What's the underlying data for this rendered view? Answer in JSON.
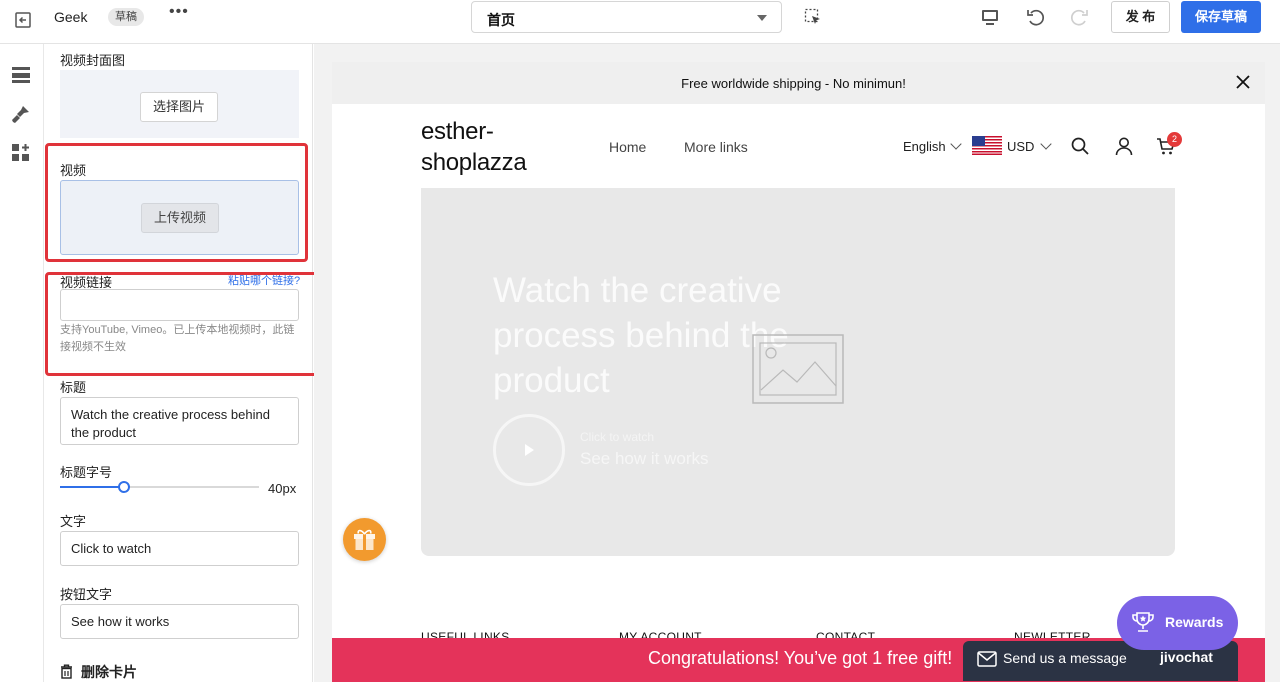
{
  "topbar": {
    "title": "Geek",
    "badge": "草稿",
    "page_select": "首页",
    "publish": "发 布",
    "save_draft": "保存草稿"
  },
  "panel": {
    "cover_label": "视频封面图",
    "choose_image": "选择图片",
    "video_label": "视频",
    "upload_video": "上传视频",
    "video_link_label": "视频链接",
    "paste_link": "粘贴哪个链接?",
    "video_link_value": "",
    "video_link_help": "支持YouTube, Vimeo。已上传本地视频时，此链接视频不生效",
    "heading_label": "标题",
    "heading_value": "Watch the creative process behind the product",
    "heading_size_label": "标题字号",
    "heading_size_value": "40px",
    "heading_size_fraction": 0.32,
    "text_label": "文字",
    "text_value": "Click to watch",
    "button_text_label": "按钮文字",
    "button_text_value": "See how it works",
    "delete_card": "删除卡片"
  },
  "preview": {
    "announcement": "Free worldwide shipping - No minimun!",
    "logo_line1": "esther-",
    "logo_line2": "shoplazza",
    "nav": [
      "Home",
      "More links"
    ],
    "language": "English",
    "currency": "USD",
    "cart_count": "2",
    "hero_title": "Watch the creative process behind the product",
    "hero_small": "Click to watch",
    "hero_cta": "See how it works",
    "footer_headings": [
      "USEFUL LINKS",
      "MY ACCOUNT",
      "CONTACT",
      "NEWLETTER"
    ],
    "congrats": "Congratulations! You’ve got 1 free gift!",
    "chat_text": "Send us a message",
    "chat_brand": "jivochat",
    "rewards": "Rewards"
  },
  "colors": {
    "accent": "#2f6fe8",
    "highlight": "#e0333a",
    "congrats_bar": "#e4335a",
    "rewards": "#7b62e6",
    "chat": "#2b3344"
  }
}
